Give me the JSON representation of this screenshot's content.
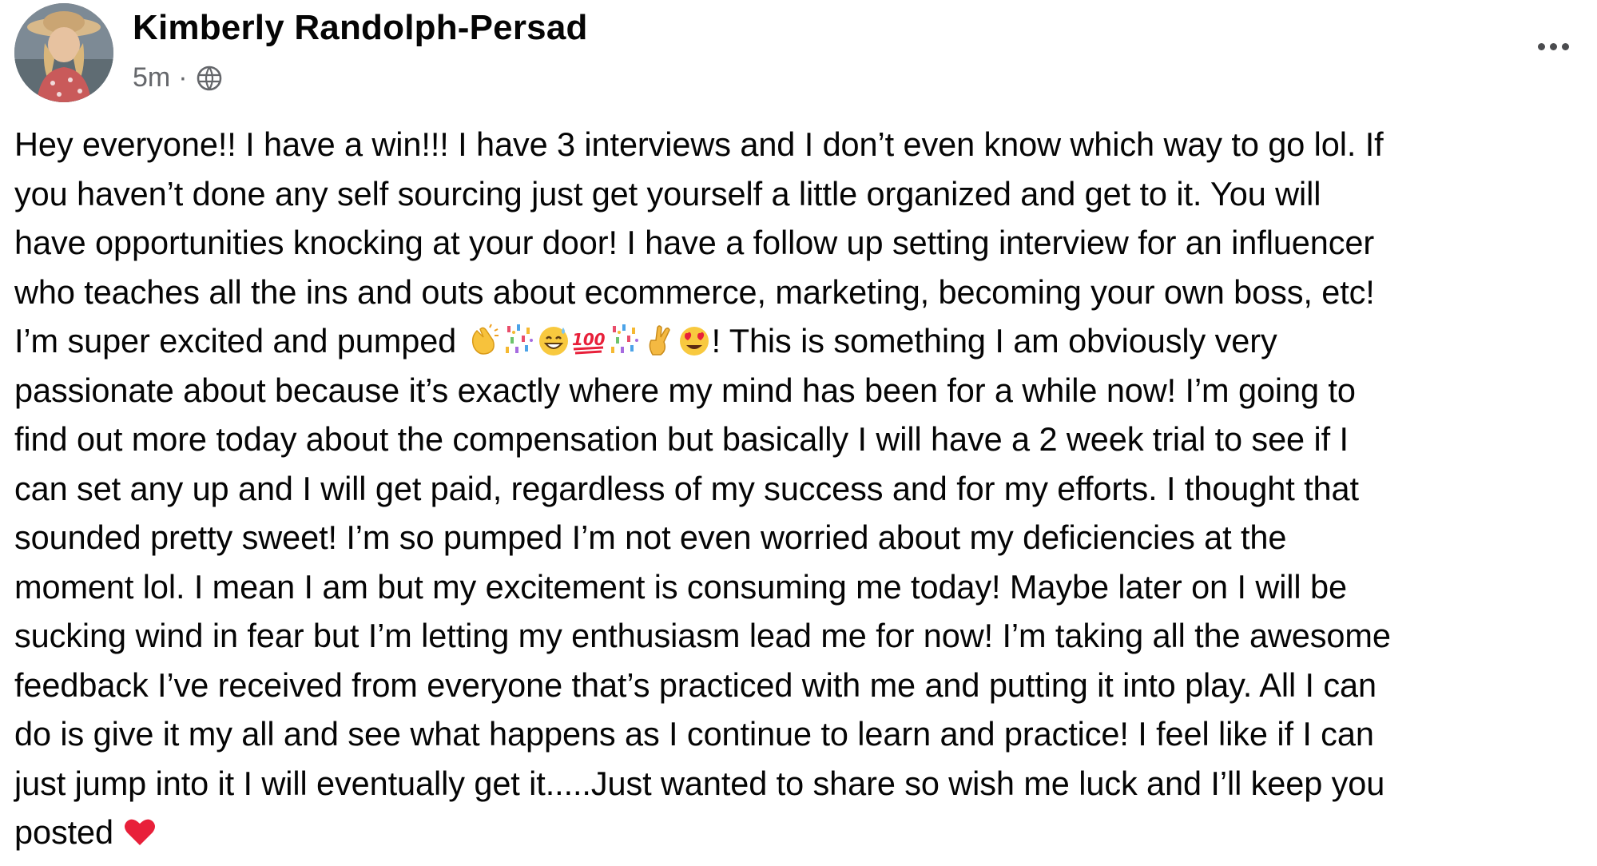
{
  "post": {
    "author": "Kimberly Randolph-Persad",
    "time": "5m",
    "separator": "·",
    "privacy_icon": "globe-icon",
    "more_icon": "more-options-icon",
    "lines": [
      "Hey everyone!!  I have a win!!! I have 3 interviews and I don’t even know which way to go lol. If",
      "you haven’t done any self sourcing just get yourself a little organized and get to it. You will",
      "have opportunities knocking at your door! I have a follow up setting interview for an influencer",
      "who teaches all the ins and outs about ecommerce, marketing, becoming your own boss, etc!",
      "I’m super excited and pumped ",
      "! This is something I am obviously very",
      "passionate about because it’s exactly where my mind has been for a while now! I’m going to",
      "find out more today about the compensation but basically I will have a 2 week trial to see if I",
      "can set any up and I will get paid, regardless of my success and for my efforts. I thought that",
      "sounded pretty sweet! I’m so pumped I’m not even worried about my deficiencies at the",
      "moment lol. I mean I am but my excitement is consuming me today! Maybe later on I will be",
      "sucking wind in fear but I’m letting my enthusiasm lead me for now! I’m taking all the awesome",
      "feedback I’ve received from everyone that’s practiced with me and putting it into play. All I can",
      "do is give it my all and see what happens as I continue to learn and practice! I feel like if I can",
      "just jump into it I will eventually get it.....Just wanted to share so wish me luck and I’ll keep you",
      "posted "
    ],
    "emojis_line5": [
      "clapping-hands-icon",
      "confetti-icon",
      "grinning-sweat-icon",
      "hundred-points-icon",
      "confetti-icon",
      "crossed-fingers-icon",
      "heart-eyes-icon"
    ],
    "emoji_last": "red-heart-icon"
  }
}
